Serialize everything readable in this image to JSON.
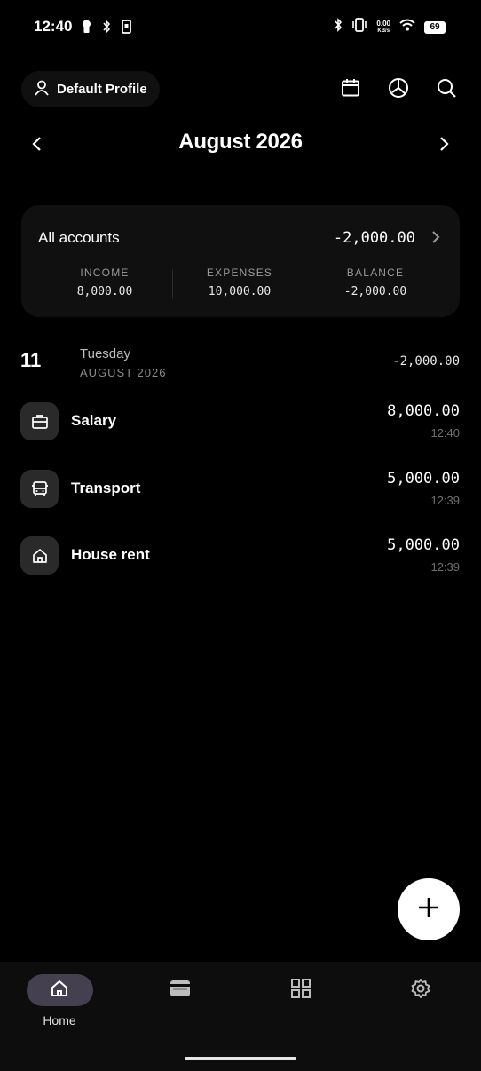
{
  "status_bar": {
    "time": "12:40",
    "net_speed_value": "0.00",
    "net_speed_unit": "KB/s",
    "battery": "69"
  },
  "header": {
    "profile_label": "Default Profile",
    "icons": [
      "calendar-icon",
      "chart-icon",
      "search-icon"
    ]
  },
  "month_nav": {
    "title": "August 2026"
  },
  "account_card": {
    "title": "All accounts",
    "total": "-2,000.00",
    "columns": [
      {
        "label": "INCOME",
        "value": "8,000.00"
      },
      {
        "label": "EXPENSES",
        "value": "10,000.00"
      },
      {
        "label": "BALANCE",
        "value": "-2,000.00"
      }
    ]
  },
  "day_group": {
    "day_number": "11",
    "weekday": "Tuesday",
    "month_year": "AUGUST 2026",
    "total": "-2,000.00"
  },
  "transactions": [
    {
      "label": "Salary",
      "amount": "8,000.00",
      "time": "12:40",
      "icon": "briefcase-icon"
    },
    {
      "label": "Transport",
      "amount": "5,000.00",
      "time": "12:39",
      "icon": "bus-icon"
    },
    {
      "label": "House rent",
      "amount": "5,000.00",
      "time": "12:39",
      "icon": "house-icon"
    }
  ],
  "bottom_nav": {
    "items": [
      {
        "label": "Home",
        "icon": "home-icon",
        "active": true
      },
      {
        "label": "",
        "icon": "wallet-icon",
        "active": false
      },
      {
        "label": "",
        "icon": "grid-icon",
        "active": false
      },
      {
        "label": "",
        "icon": "gear-icon",
        "active": false
      }
    ]
  },
  "colors": {
    "background": "#000000",
    "card": "#101010",
    "active_nav_pill": "#454050",
    "muted_text": "#6f6f6f"
  }
}
